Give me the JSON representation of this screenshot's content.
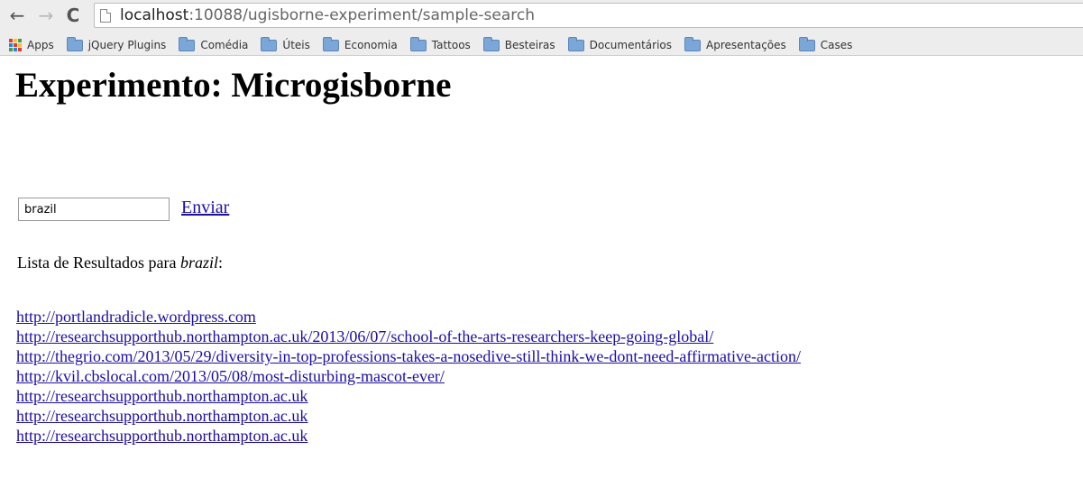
{
  "browser": {
    "back_glyph": "←",
    "forward_glyph": "→",
    "reload_glyph": "C",
    "url_host": "localhost",
    "url_path": ":10088/ugisborne-experiment/sample-search"
  },
  "bookmarks": {
    "apps_label": "Apps",
    "apps_colors": [
      "#e53935",
      "#fbc02d",
      "#43a047",
      "#1e88e5",
      "#e53935",
      "#fbc02d",
      "#43a047",
      "#1e88e5",
      "#e53935"
    ],
    "folders": [
      "jQuery Plugins",
      "Comédia",
      "Úteis",
      "Economia",
      "Tattoos",
      "Besteiras",
      "Documentários",
      "Apresentações",
      "Cases"
    ]
  },
  "page": {
    "title": "Experimento: Microgisborne",
    "search": {
      "value": "brazil"
    },
    "send_label": "Enviar",
    "results_prefix": "Lista de Resultados para ",
    "results_query": "brazil",
    "results_suffix": ":",
    "results": [
      "http://portlandradicle.wordpress.com",
      "http://researchsupporthub.northampton.ac.uk/2013/06/07/school-of-the-arts-researchers-keep-going-global/",
      "http://thegrio.com/2013/05/29/diversity-in-top-professions-takes-a-nosedive-still-think-we-dont-need-affirmative-action/",
      "http://kvil.cbslocal.com/2013/05/08/most-disturbing-mascot-ever/",
      "http://researchsupporthub.northampton.ac.uk",
      "http://researchsupporthub.northampton.ac.uk",
      "http://researchsupporthub.northampton.ac.uk"
    ]
  },
  "colors": {
    "link": "#1a0dab",
    "folder": "#7aa6d8"
  }
}
